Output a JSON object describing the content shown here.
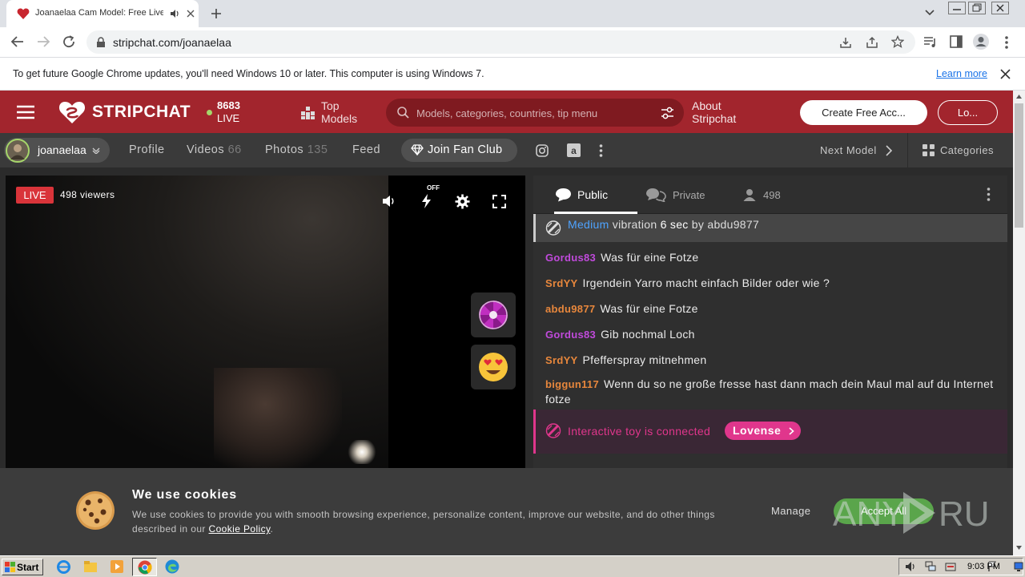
{
  "browser": {
    "tab_title": "Joanaelaa Cam Model: Free Live",
    "url": "stripchat.com/joanaelaa",
    "infobar_message": "To get future Google Chrome updates, you'll need Windows 10 or later. This computer is using Windows 7.",
    "infobar_link": "Learn more"
  },
  "header": {
    "logo": "STRIPCHAT",
    "live_count": "8683",
    "live_label": "LIVE",
    "top_models_line1": "Top",
    "top_models_line2": "Models",
    "search_placeholder": "Models, categories, countries, tip menu",
    "about_line1": "About",
    "about_line2": "Stripchat",
    "create_account": "Create Free Acc...",
    "login": "Lo..."
  },
  "model_nav": {
    "username": "joanaelaa",
    "links": [
      {
        "label": "Profile",
        "count": ""
      },
      {
        "label": "Videos",
        "count": "66"
      },
      {
        "label": "Photos",
        "count": "135"
      },
      {
        "label": "Feed",
        "count": ""
      }
    ],
    "fan_club": "Join Fan Club",
    "next_model": "Next Model",
    "categories": "Categories"
  },
  "video": {
    "live_badge": "LIVE",
    "viewers": "498 viewers",
    "lightning_state": "OFF"
  },
  "chat": {
    "tab_public": "Public",
    "tab_private": "Private",
    "user_count": "498",
    "tip": {
      "level": "Medium",
      "text": "vibration",
      "duration": "6 sec",
      "by": "by abdu9877"
    },
    "messages": [
      {
        "user": "Gordus83",
        "color": "#c04adb",
        "text": "Was für eine Fotze"
      },
      {
        "user": "SrdYY",
        "color": "#e8873c",
        "text": "Irgendein Yarro macht einfach Bilder oder wie ?"
      },
      {
        "user": "abdu9877",
        "color": "#e8873c",
        "text": "Was für eine Fotze"
      },
      {
        "user": "Gordus83",
        "color": "#c04adb",
        "text": "Gib nochmal Loch"
      },
      {
        "user": "SrdYY",
        "color": "#e8873c",
        "text": "Pfefferspray mitnehmen"
      },
      {
        "user": "biggun117",
        "color": "#e8873c",
        "text": "Wenn du so ne große fresse hast dann mach dein Maul mal auf du Internet fotze"
      }
    ],
    "toy_message": "Interactive toy is connected",
    "toy_button": "Lovense"
  },
  "cookie": {
    "title": "We use cookies",
    "text": "We use cookies to provide you with smooth browsing experience, personalize content, improve our website, and do other things described in our",
    "policy_link": "Cookie Policy",
    "manage": "Manage",
    "accept": "Accept All"
  },
  "taskbar": {
    "start": "Start",
    "clock": "9:03 PM"
  },
  "colors": {
    "brand_red": "#a2252d",
    "accent_pink": "#e0368c",
    "accept_green": "#5aa54b"
  }
}
